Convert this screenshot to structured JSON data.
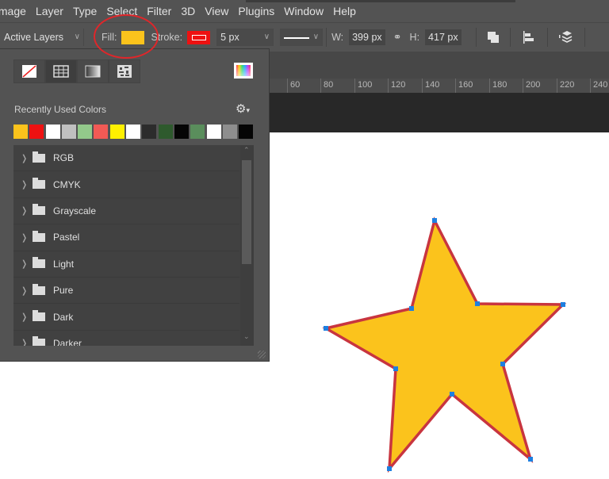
{
  "menubar": {
    "items": [
      "Image",
      "Layer",
      "Type",
      "Select",
      "Filter",
      "3D",
      "View",
      "Plugins",
      "Window",
      "Help"
    ]
  },
  "options_bar": {
    "target_dropdown": "Active Layers",
    "fill_label": "Fill:",
    "fill_color": "#fbc31c",
    "stroke_label": "Stroke:",
    "stroke_color": "#ee1111",
    "stroke_width": "5 px",
    "width_label": "W:",
    "width_value": "399 px",
    "height_label": "H:",
    "height_value": "417 px",
    "icons": [
      "link-icon",
      "path-operations-icon",
      "path-alignment-icon",
      "path-arrangement-icon"
    ]
  },
  "ruler": {
    "ticks": [
      "60",
      "80",
      "100",
      "120",
      "140",
      "160",
      "180",
      "200",
      "220",
      "240"
    ]
  },
  "fill_panel": {
    "modes": [
      "no-color",
      "solid-color",
      "gradient",
      "pattern"
    ],
    "active_mode": "solid-color",
    "recent_title": "Recently Used Colors",
    "recent_colors": [
      "#fbc31c",
      "#ee1111",
      "#ffffff",
      "#c0c0c0",
      "#93c98b",
      "#f15a55",
      "#fff000",
      "#ffffff",
      "#2c2c2c",
      "#2e5a2d",
      "#050505",
      "#5a8e5c",
      "#ffffff",
      "#8e8e8e",
      "#050505"
    ],
    "folders": [
      "RGB",
      "CMYK",
      "Grayscale",
      "Pastel",
      "Light",
      "Pure",
      "Dark",
      "Darker"
    ]
  },
  "shape": {
    "type": "star",
    "fill": "#fbc31c",
    "stroke": "#c8353f",
    "anchor_color": "#1e7fe0"
  },
  "annotation": {
    "highlight": "Fill control circled in red"
  }
}
